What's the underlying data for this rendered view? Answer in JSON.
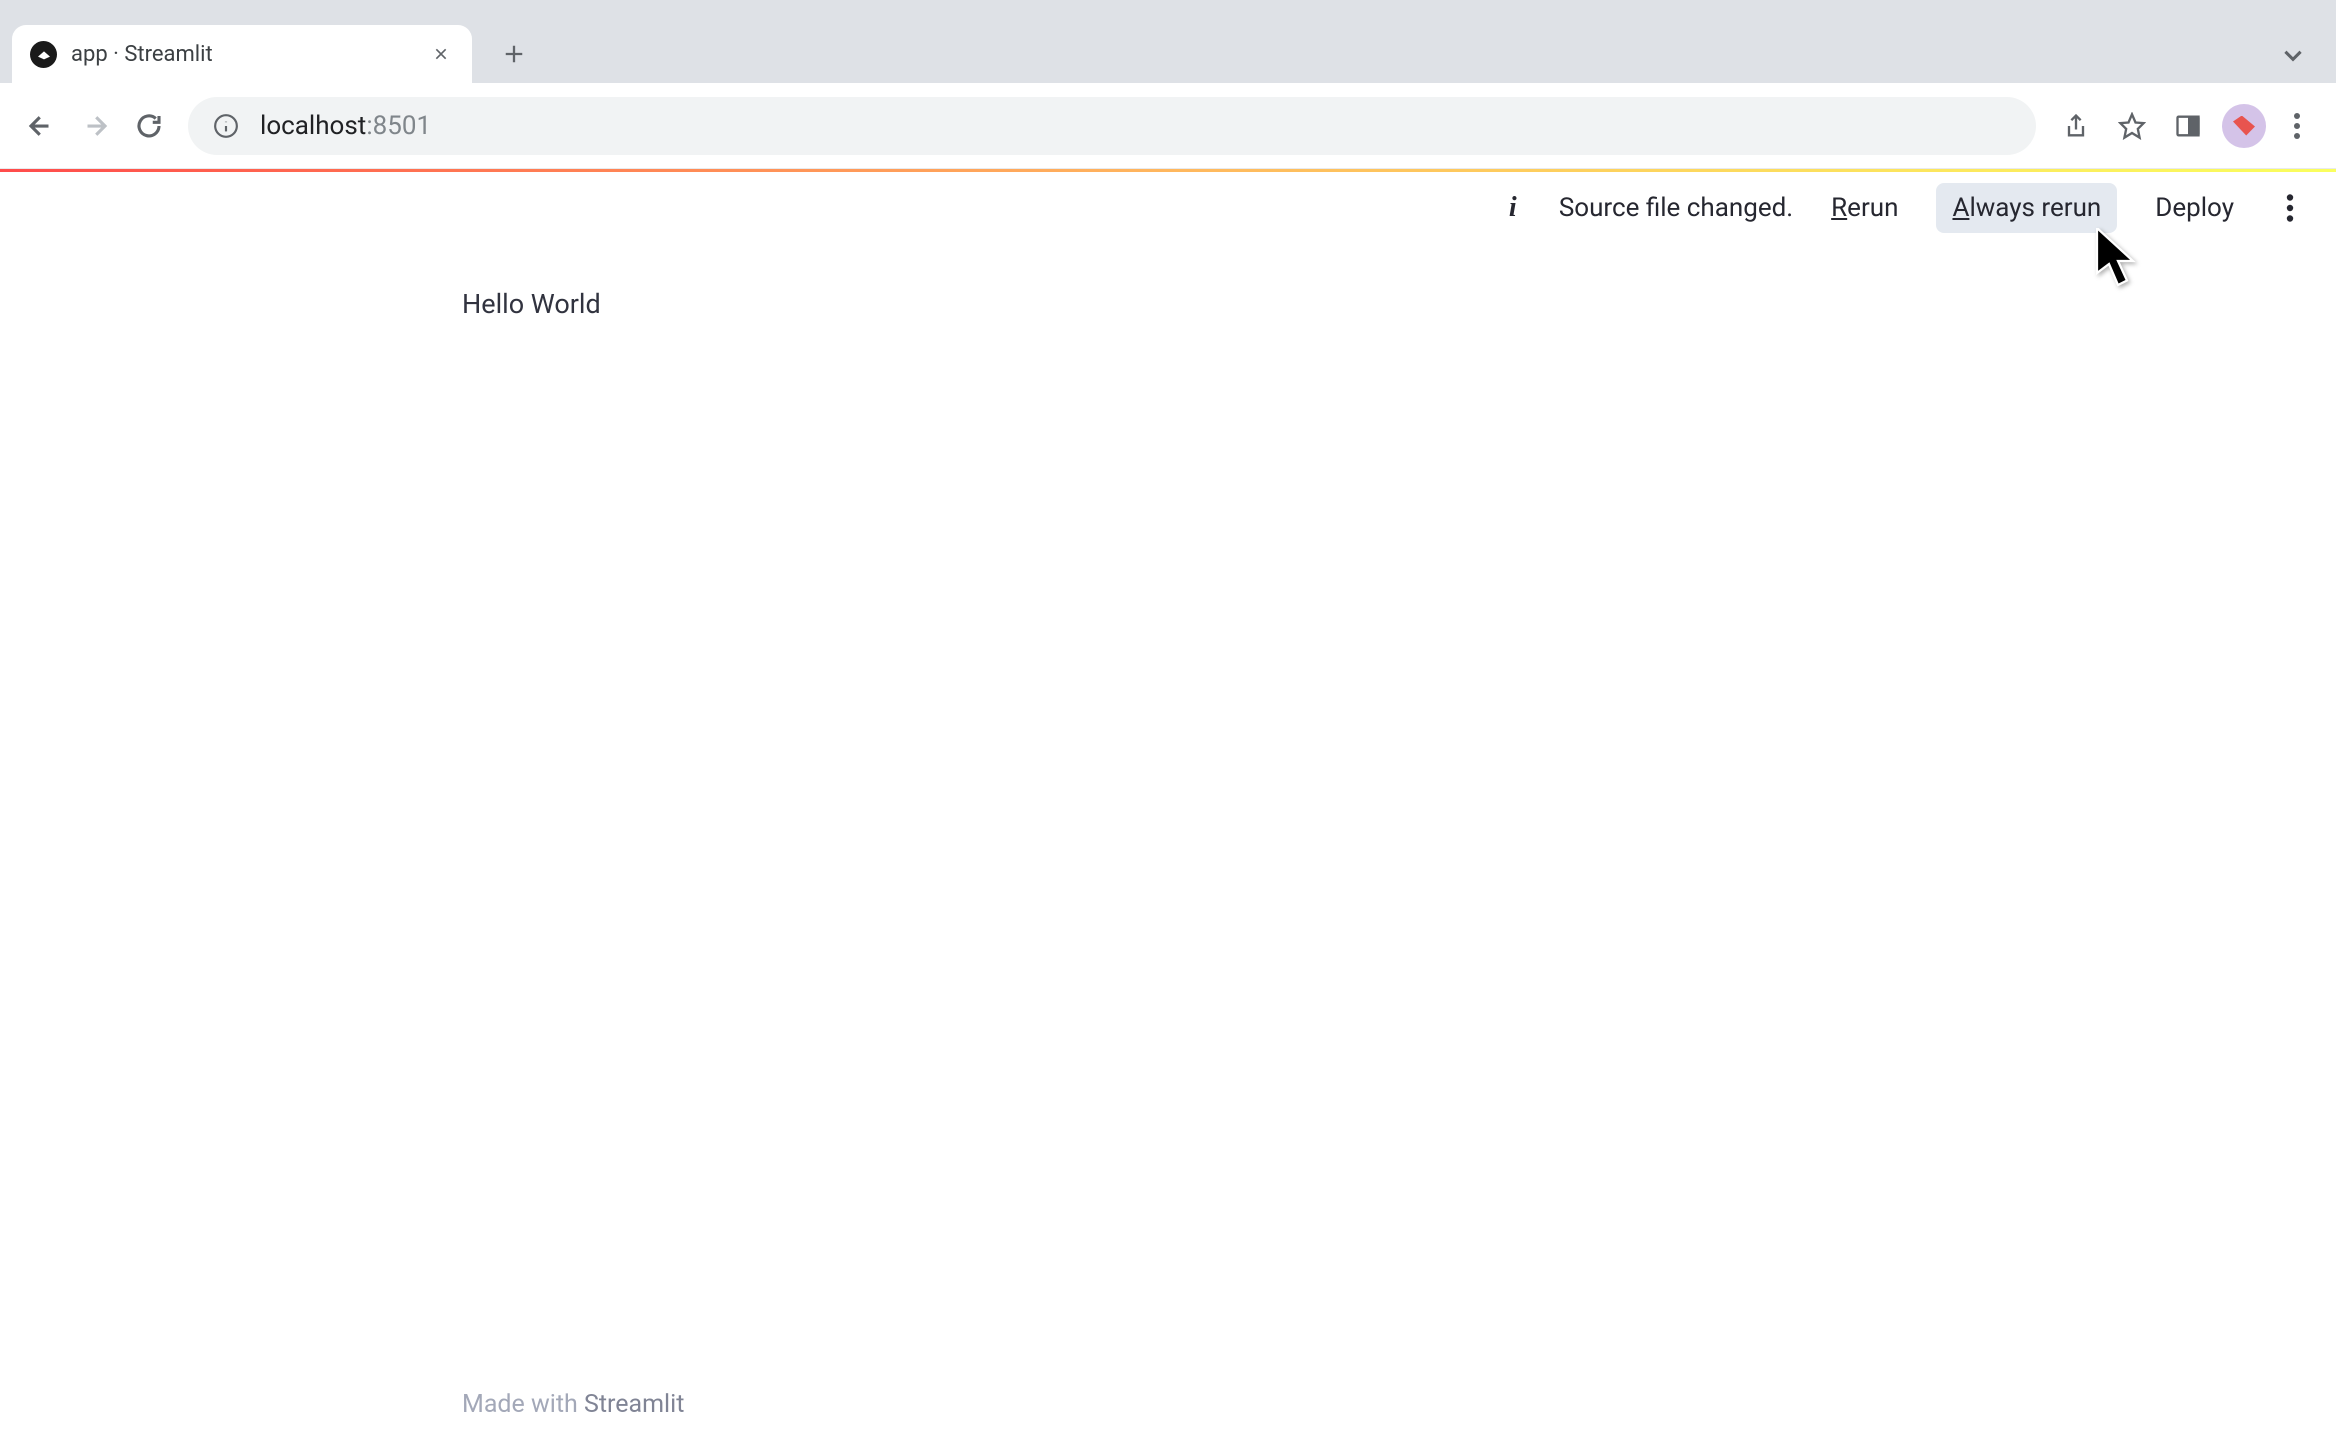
{
  "browser": {
    "tab": {
      "title": "app · Streamlit"
    },
    "url": {
      "host": "localhost",
      "port": ":8501"
    }
  },
  "app": {
    "header": {
      "status_text": "Source file changed.",
      "rerun_prefix": "R",
      "rerun_rest": "erun",
      "always_rerun_prefix": "A",
      "always_rerun_rest": "lways rerun",
      "deploy": "Deploy"
    },
    "content": {
      "main_text": "Hello World"
    },
    "footer": {
      "prefix": "Made with ",
      "brand": "Streamlit"
    }
  }
}
